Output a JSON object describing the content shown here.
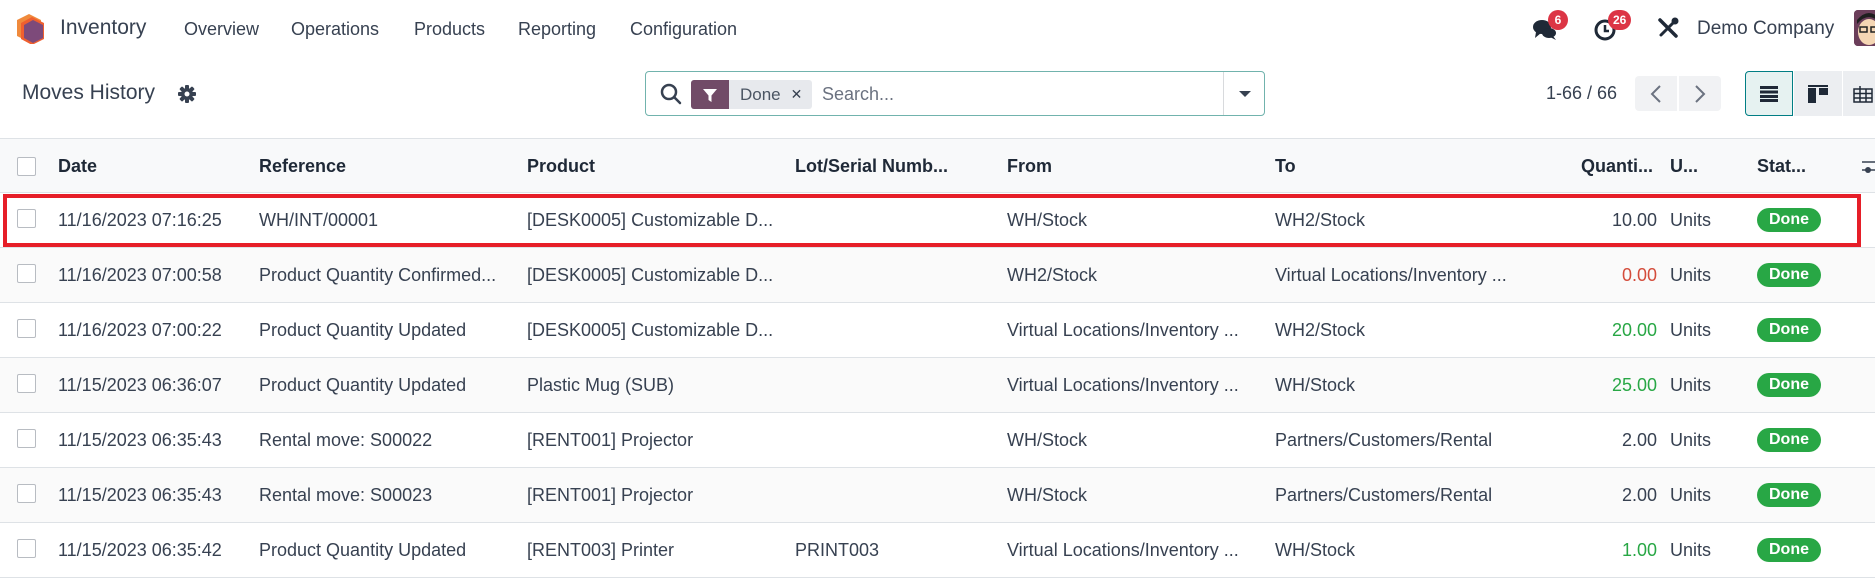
{
  "navbar": {
    "app_name": "Inventory",
    "menu": [
      {
        "label": "Overview"
      },
      {
        "label": "Operations"
      },
      {
        "label": "Products"
      },
      {
        "label": "Reporting"
      },
      {
        "label": "Configuration"
      }
    ],
    "messages_badge": "6",
    "activities_badge": "26",
    "company": "Demo Company",
    "icons": {
      "logo": "inventory-hex-logo",
      "messages": "chat-bubbles-icon",
      "activities": "clock-icon",
      "debug": "tools-icon",
      "avatar": "user-avatar"
    }
  },
  "control_panel": {
    "title": "Moves History",
    "search": {
      "facet_label": "Done",
      "facet_icon": "filter-icon",
      "placeholder": "Search..."
    },
    "pager": {
      "value": "1-66 / 66"
    },
    "views": [
      {
        "name": "list",
        "active": true
      },
      {
        "name": "kanban",
        "active": false
      },
      {
        "name": "pivot",
        "active": false
      }
    ]
  },
  "table": {
    "columns": [
      "Date",
      "Reference",
      "Product",
      "Lot/Serial Numb...",
      "From",
      "To",
      "Quanti...",
      "U...",
      "Stat..."
    ],
    "rows": [
      {
        "date": "11/16/2023 07:16:25",
        "reference": "WH/INT/00001",
        "product": "[DESK0005] Customizable D...",
        "lot": "",
        "from": "WH/Stock",
        "to": "WH2/Stock",
        "quantity": "10.00",
        "qty_color": "neutral",
        "uom": "Units",
        "status": "Done",
        "highlighted": true
      },
      {
        "date": "11/16/2023 07:00:58",
        "reference": "Product Quantity Confirmed...",
        "product": "[DESK0005] Customizable D...",
        "lot": "",
        "from": "WH2/Stock",
        "to": "Virtual Locations/Inventory ...",
        "quantity": "0.00",
        "qty_color": "negative",
        "uom": "Units",
        "status": "Done"
      },
      {
        "date": "11/16/2023 07:00:22",
        "reference": "Product Quantity Updated",
        "product": "[DESK0005] Customizable D...",
        "lot": "",
        "from": "Virtual Locations/Inventory ...",
        "to": "WH2/Stock",
        "quantity": "20.00",
        "qty_color": "positive",
        "uom": "Units",
        "status": "Done"
      },
      {
        "date": "11/15/2023 06:36:07",
        "reference": "Product Quantity Updated",
        "product": "Plastic Mug (SUB)",
        "lot": "",
        "from": "Virtual Locations/Inventory ...",
        "to": "WH/Stock",
        "quantity": "25.00",
        "qty_color": "positive",
        "uom": "Units",
        "status": "Done"
      },
      {
        "date": "11/15/2023 06:35:43",
        "reference": "Rental move: S00022",
        "product": "[RENT001] Projector",
        "lot": "",
        "from": "WH/Stock",
        "to": "Partners/Customers/Rental",
        "quantity": "2.00",
        "qty_color": "neutral",
        "uom": "Units",
        "status": "Done"
      },
      {
        "date": "11/15/2023 06:35:43",
        "reference": "Rental move: S00023",
        "product": "[RENT001] Projector",
        "lot": "",
        "from": "WH/Stock",
        "to": "Partners/Customers/Rental",
        "quantity": "2.00",
        "qty_color": "neutral",
        "uom": "Units",
        "status": "Done"
      },
      {
        "date": "11/15/2023 06:35:42",
        "reference": "Product Quantity Updated",
        "product": "[RENT003] Printer",
        "lot": "PRINT003",
        "from": "Virtual Locations/Inventory ...",
        "to": "WH/Stock",
        "quantity": "1.00",
        "qty_color": "positive",
        "uom": "Units",
        "status": "Done"
      }
    ]
  },
  "colors": {
    "brand": "#714b67",
    "accent": "#017e84",
    "status_done": "#28a745",
    "qty_negative": "#d44c3b",
    "qty_positive": "#28a745",
    "badge": "#dc3545",
    "highlight": "#e61e28"
  }
}
